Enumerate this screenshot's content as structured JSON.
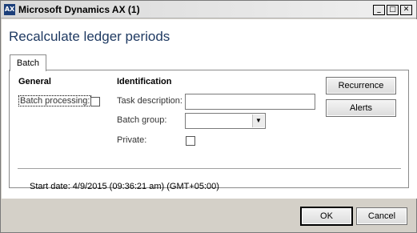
{
  "window": {
    "title": "Microsoft Dynamics AX (1)",
    "icon": "dynamics-ax-icon",
    "controls": {
      "minimize": "_",
      "maximize": "□",
      "close": "✕"
    }
  },
  "page": {
    "title": "Recalculate ledger periods"
  },
  "tabs": [
    {
      "label": "Batch",
      "selected": true
    }
  ],
  "general": {
    "heading": "General",
    "batch_processing_label": "Batch processing:",
    "batch_processing_checked": false
  },
  "identification": {
    "heading": "Identification",
    "task_description_label": "Task description:",
    "task_description_value": "",
    "batch_group_label": "Batch group:",
    "batch_group_value": "",
    "private_label": "Private:",
    "private_checked": false
  },
  "side_buttons": {
    "recurrence": "Recurrence",
    "alerts": "Alerts"
  },
  "start_date": "Start date: 4/9/2015 (09:36:21 am) (GMT+05:00)",
  "footer": {
    "ok": "OK",
    "cancel": "Cancel"
  },
  "colors": {
    "title_text": "#1f3a62",
    "dialog_background": "#d4d0c8",
    "client_background": "#ffffff"
  }
}
